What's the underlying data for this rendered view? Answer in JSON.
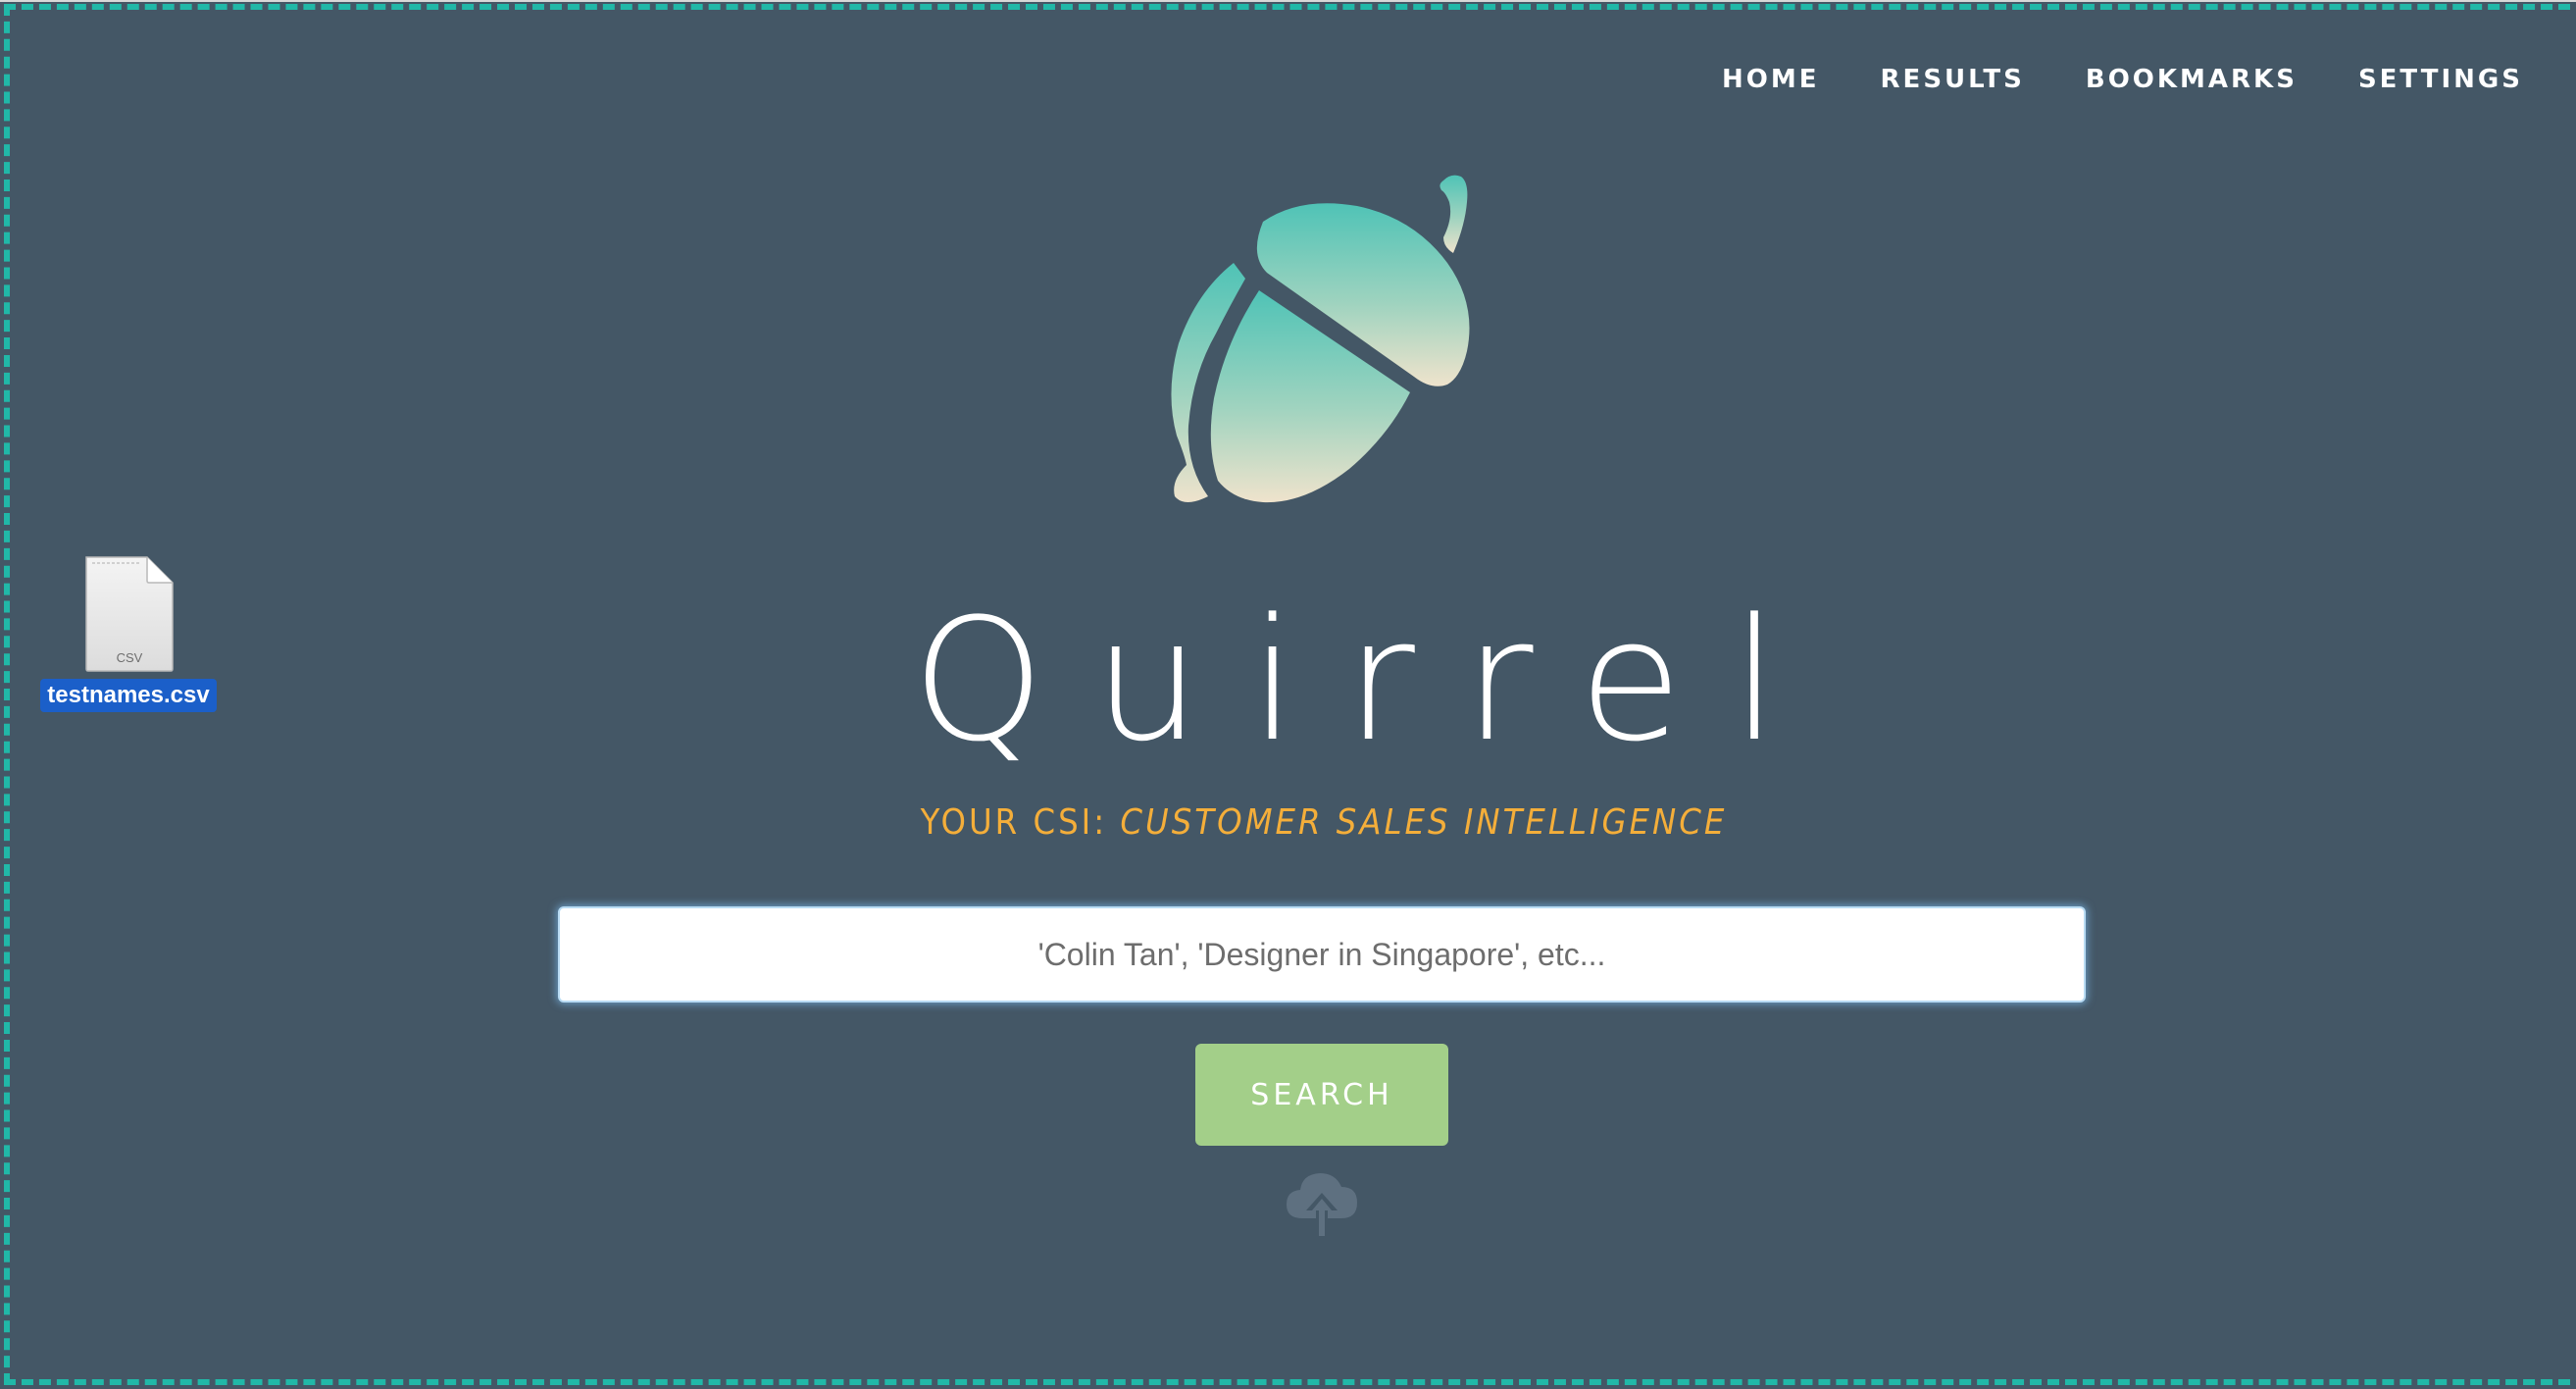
{
  "nav": {
    "items": [
      {
        "label": "HOME"
      },
      {
        "label": "RESULTS"
      },
      {
        "label": "BOOKMARKS"
      },
      {
        "label": "SETTINGS"
      }
    ]
  },
  "desktop_file": {
    "name": "testnames.csv",
    "type_label": "CSV",
    "icon": "csv-file-icon"
  },
  "brand": {
    "title": "Quirrel",
    "tagline_prefix": "YOUR CSI: ",
    "tagline_emphasis": "CUSTOMER SALES INTELLIGENCE",
    "logo_icon": "acorn-logo-icon"
  },
  "search": {
    "placeholder": "'Colin Tan', 'Designer in Singapore', etc...",
    "value": "",
    "button_label": "SEARCH",
    "upload_icon": "cloud-upload-icon"
  },
  "colors": {
    "background": "#445766",
    "drop_zone_border": "#21b8a8",
    "tagline": "#f4ae3a",
    "search_button": "#a3cf89",
    "logo_gradient_top": "#4fc3b6",
    "logo_gradient_bottom": "#efe3cc"
  }
}
